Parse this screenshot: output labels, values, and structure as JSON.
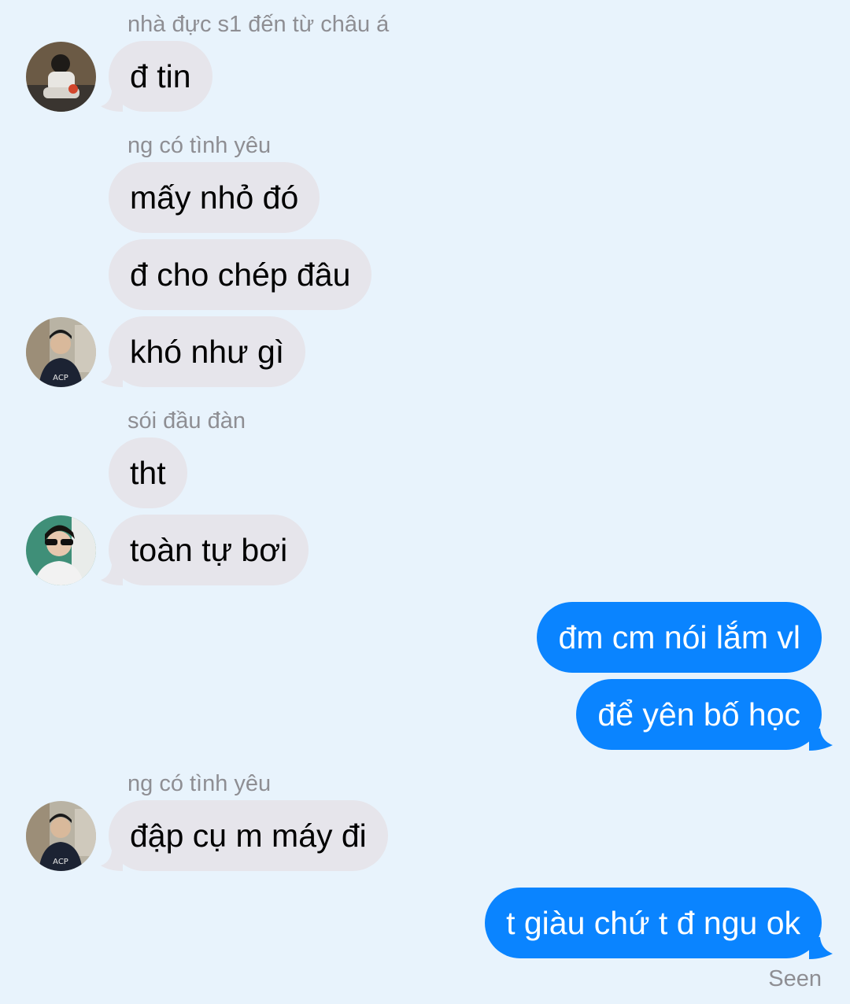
{
  "messages": [
    {
      "sender_label": "nhà đực s1 đến từ châu á",
      "text": "đ tin"
    },
    {
      "sender_label": "ng có tình yêu",
      "text": "mấy nhỏ đó"
    },
    {
      "text": "đ cho chép đâu"
    },
    {
      "text": "khó như gì"
    },
    {
      "sender_label": "sói đầu đàn",
      "text": "tht"
    },
    {
      "text": "toàn tự bơi"
    },
    {
      "text": "đm cm nói lắm vl"
    },
    {
      "text": "để yên bố học"
    },
    {
      "sender_label": "ng có tình yêu",
      "text": "đập cụ m máy đi"
    },
    {
      "text": "t giàu chứ t đ ngu ok"
    }
  ],
  "status": "Seen",
  "colors": {
    "background": "#E8F3FC",
    "incoming_bubble": "#E6E5EB",
    "outgoing_bubble": "#0A84FF",
    "sender_label": "#8E8E93"
  },
  "avatars": [
    "avatar-icon",
    "avatar-icon",
    "avatar-icon",
    "avatar-icon"
  ]
}
